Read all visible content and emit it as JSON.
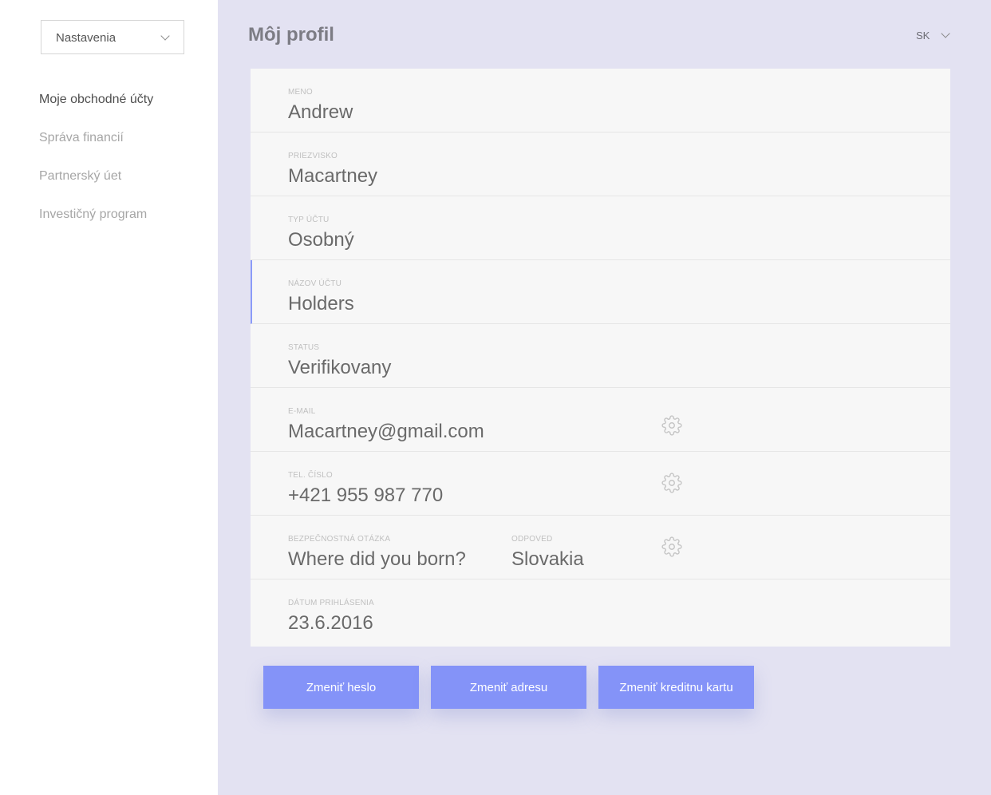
{
  "sidebar": {
    "select": {
      "value": "Nastavenia"
    },
    "nav": [
      {
        "label": "Moje obchodné účty",
        "active": true
      },
      {
        "label": "Správa financií"
      },
      {
        "label": "Partnerský úet"
      },
      {
        "label": "Investičný program"
      }
    ]
  },
  "header": {
    "title": "Môj profil",
    "language": "SK"
  },
  "profile": {
    "first_name": {
      "label": "MENO",
      "value": "Andrew"
    },
    "last_name": {
      "label": "PRIEZVISKO",
      "value": "Macartney"
    },
    "account_type": {
      "label": "TYP ÚČTU",
      "value": "Osobný"
    },
    "account_name": {
      "label": "NÁZOV ÚČTU",
      "value": "Holders"
    },
    "status": {
      "label": "STATUS",
      "value": "Verifikovany"
    },
    "email": {
      "label": "E-MAIL",
      "value": "Macartney@gmail.com"
    },
    "phone": {
      "label": "TEL. ČÍSLO",
      "value": "+421 955 987 770"
    },
    "security_question": {
      "label": "BEZPEČNOSTNÁ OTÁZKA",
      "value": "Where did you born?"
    },
    "answer": {
      "label": "ODPOVED",
      "value": "Slovakia"
    },
    "login_date": {
      "label": "DÁTUM PRIHLÁSENIA",
      "value": "23.6.2016"
    }
  },
  "actions": {
    "change_password": "Zmeniť heslo",
    "change_address": "Zmeniť adresu",
    "change_card": "Zmeniť kreditnu kartu"
  },
  "colors": {
    "accent": "#8493f8",
    "background": "#e3e2f2",
    "card": "#f7f7f7"
  },
  "icons": {
    "settings": "gear-icon",
    "dropdown": "chevron-down-icon"
  }
}
